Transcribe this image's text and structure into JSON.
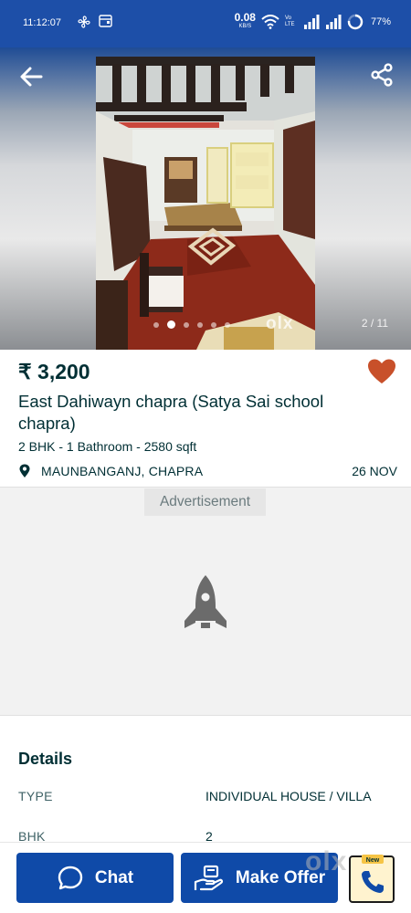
{
  "status_bar": {
    "time": "11:12:07",
    "speed_value": "0.08",
    "speed_unit": "KB/S",
    "volte": "Vo LTE",
    "battery": "77%",
    "icons": [
      "fan-icon",
      "wallet-icon",
      "wifi-icon",
      "signal-icon",
      "signal-icon",
      "battery-ring-icon"
    ]
  },
  "gallery": {
    "counter": "2 / 11",
    "watermark": "olx",
    "dot_count": 6,
    "active_dot": 1
  },
  "listing": {
    "price": "₹ 3,200",
    "title": "East Dahiwayn chapra (Satya Sai school chapra)",
    "specs": "2 BHK - 1 Bathroom - 2580 sqft",
    "location": "MAUNBANGANJ, CHAPRA",
    "date": "26 NOV",
    "favourited": true
  },
  "ad": {
    "label": "Advertisement"
  },
  "details": {
    "heading": "Details",
    "rows": [
      {
        "key": "TYPE",
        "value": "INDIVIDUAL HOUSE / VILLA"
      },
      {
        "key": "BHK",
        "value": "2"
      }
    ]
  },
  "actions": {
    "chat_label": "Chat",
    "offer_label": "Make Offer",
    "call_badge": "New"
  },
  "colors": {
    "primary": "#0f4aa8",
    "status_bar": "#1d4fa8",
    "text": "#002f34",
    "favourite": "#c8502a"
  }
}
